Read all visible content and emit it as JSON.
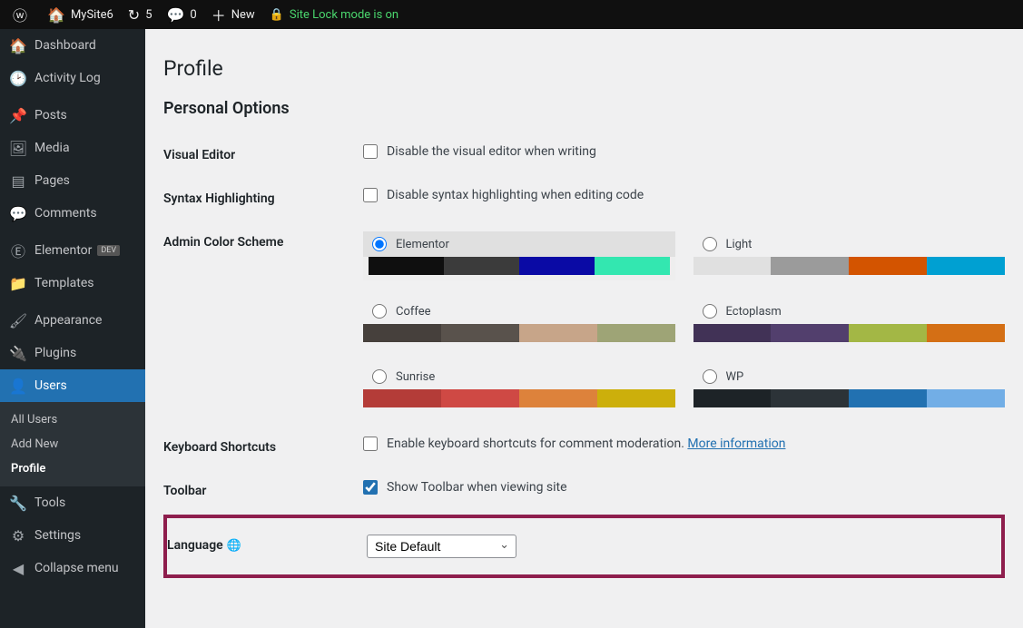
{
  "adminbar": {
    "site_name": "MySite6",
    "updates_count": "5",
    "comments_count": "0",
    "new_label": "New",
    "lock_label": "Site Lock mode is on"
  },
  "sidebar": {
    "dashboard": "Dashboard",
    "activity_log": "Activity Log",
    "posts": "Posts",
    "media": "Media",
    "pages": "Pages",
    "comments": "Comments",
    "elementor": "Elementor",
    "elementor_badge": "DEV",
    "templates": "Templates",
    "appearance": "Appearance",
    "plugins": "Plugins",
    "users": "Users",
    "users_sub_all": "All Users",
    "users_sub_add": "Add New",
    "users_sub_profile": "Profile",
    "tools": "Tools",
    "settings": "Settings",
    "collapse": "Collapse menu"
  },
  "page": {
    "title": "Profile",
    "section_personal": "Personal Options",
    "visual_editor_label": "Visual Editor",
    "visual_editor_cb": "Disable the visual editor when writing",
    "syntax_label": "Syntax Highlighting",
    "syntax_cb": "Disable syntax highlighting when editing code",
    "color_scheme_label": "Admin Color Scheme",
    "keyboard_label": "Keyboard Shortcuts",
    "keyboard_cb": "Enable keyboard shortcuts for comment moderation. ",
    "keyboard_link": "More information",
    "toolbar_label": "Toolbar",
    "toolbar_cb": "Show Toolbar when viewing site",
    "language_label": "Language",
    "language_value": "Site Default"
  },
  "schemes": [
    {
      "name": "Elementor",
      "selected": true,
      "colors": [
        "#0f0f0f",
        "#3b3b3b",
        "#0a0aa5",
        "#33e7b0"
      ]
    },
    {
      "name": "Light",
      "selected": false,
      "colors": [
        "#e0e0e0",
        "#9b9b9b",
        "#d35400",
        "#00a0d2"
      ]
    },
    {
      "name": "Coffee",
      "selected": false,
      "colors": [
        "#46403c",
        "#59524c",
        "#c7a589",
        "#9ea476"
      ]
    },
    {
      "name": "Ectoplasm",
      "selected": false,
      "colors": [
        "#413256",
        "#523f6d",
        "#a3b745",
        "#d46f15"
      ]
    },
    {
      "name": "Sunrise",
      "selected": false,
      "colors": [
        "#b43c38",
        "#cf4944",
        "#dd823b",
        "#ccaf0b"
      ]
    },
    {
      "name": "WP",
      "selected": false,
      "colors": [
        "#1d2327",
        "#2c3338",
        "#2271b1",
        "#72aee6"
      ]
    }
  ]
}
